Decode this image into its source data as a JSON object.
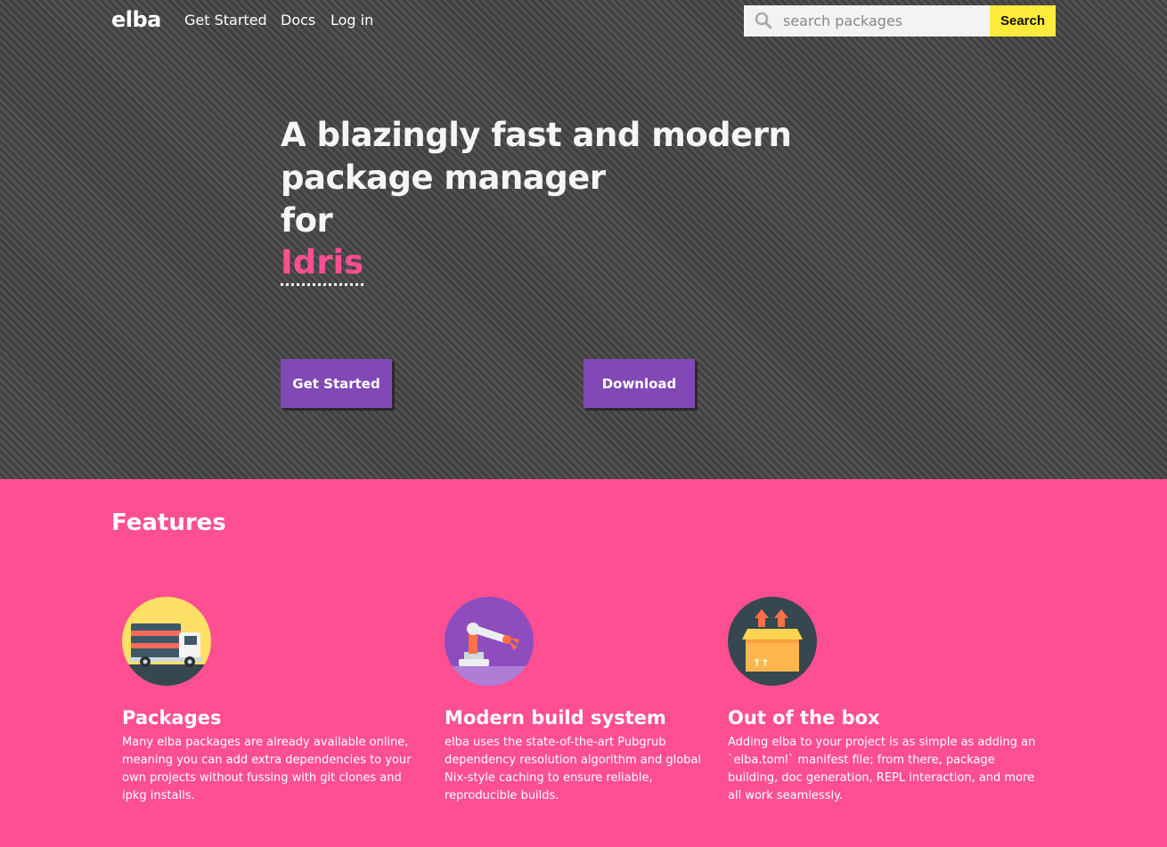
{
  "nav": {
    "logo": "elba",
    "links": [
      "Get Started",
      "Docs",
      "Log in"
    ],
    "search_placeholder": "search packages",
    "search_button": "Search"
  },
  "hero": {
    "title_lines": [
      "A blazingly fast and modern",
      "package manager",
      "for"
    ],
    "language": "Idris",
    "buttons": [
      "Get Started",
      "Download"
    ],
    "button_color": "#8049b6",
    "accent_color": "#ff4f93"
  },
  "features": {
    "heading": "Features",
    "background_color": "#ff4f93",
    "items": [
      {
        "icon": "delivery-truck-icon",
        "title": "Packages",
        "description": "Many elba packages are already available online, meaning you can add extra dependencies to your own projects without fussing with git clones and ipkg installs."
      },
      {
        "icon": "robotic-arm-icon",
        "title": "Modern build system",
        "description": "elba uses the state-of-the-art Pubgrub dependency resolution algorithm and global Nix-style caching to ensure reliable, reproducible builds."
      },
      {
        "icon": "package-box-icon",
        "title": "Out of the box",
        "description": "Adding elba to your project is as simple as adding an `elba.toml` manifest file; from there, package building, doc generation, REPL interaction, and more all work seamlessly."
      }
    ]
  }
}
